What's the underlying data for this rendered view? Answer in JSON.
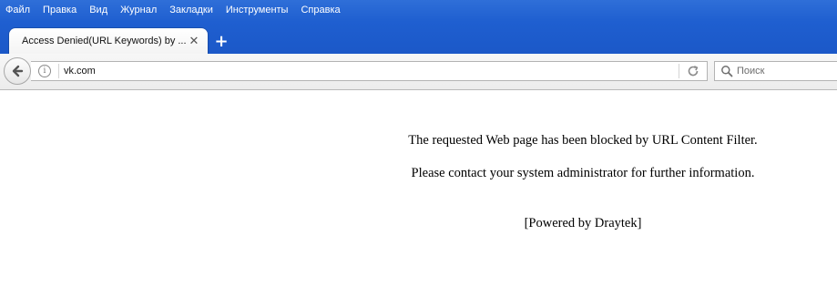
{
  "menubar": {
    "items": [
      "Файл",
      "Правка",
      "Вид",
      "Журнал",
      "Закладки",
      "Инструменты",
      "Справка"
    ]
  },
  "tabs": [
    {
      "title": "Access Denied(URL Keywords) by ...",
      "active": true
    }
  ],
  "navbar": {
    "url": "vk.com",
    "search_placeholder": "Поиск"
  },
  "page": {
    "line1": "The requested Web page has been blocked by URL Content Filter.",
    "line2": "Please contact your system administrator for further information.",
    "line3": "[Powered by Draytek]"
  },
  "icons": {
    "back": "back-arrow-icon",
    "info": "info-icon",
    "reload": "reload-icon",
    "search": "search-icon",
    "close_tab": "close-icon",
    "new_tab": "plus-icon"
  },
  "colors": {
    "chrome_blue": "#1f5fd0",
    "menu_text": "#ffffff",
    "page_bg": "#ffffff"
  }
}
